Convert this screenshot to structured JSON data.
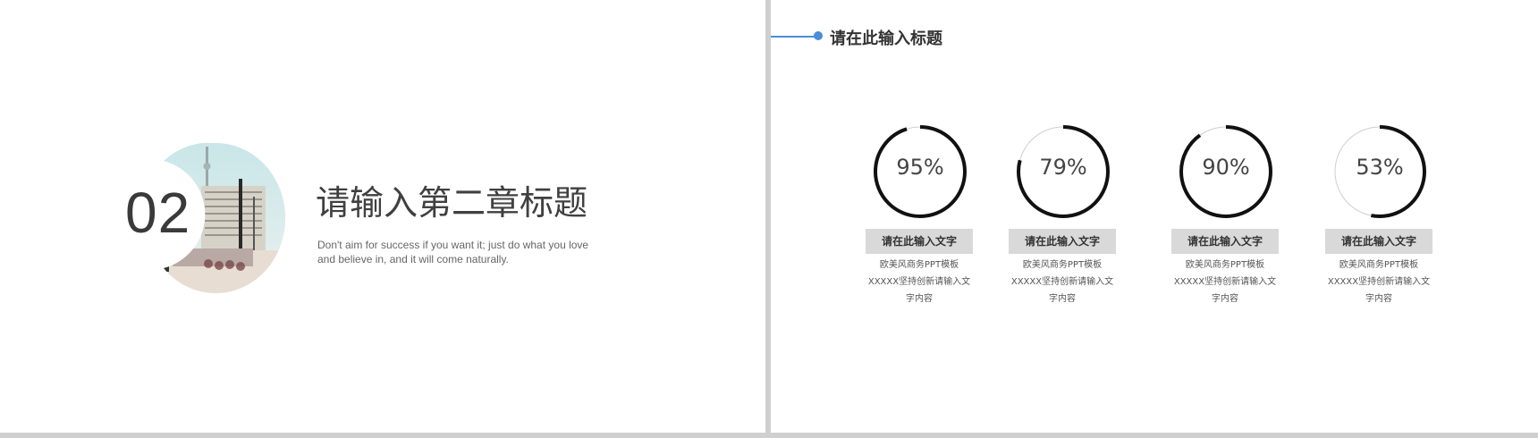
{
  "left_slide": {
    "chapter_number": "02",
    "chapter_title": "请输入第二章标题",
    "subtitle": "Don't aim for success if you want it; just do what you love and believe in, and it will come naturally.",
    "photo_description_icon": "city-street-photo-icon"
  },
  "right_slide": {
    "header_title": "请在此输入标题",
    "accent_color": "#4a8ed8",
    "stats": [
      {
        "percent_text": "95%",
        "value": 95,
        "label": "请在此输入文字",
        "desc_line1": "欧美风商务PPT模板",
        "desc_line2": "XXXXX坚持创新请输入文",
        "desc_line3": "字内容"
      },
      {
        "percent_text": "79%",
        "value": 79,
        "label": "请在此输入文字",
        "desc_line1": "欧美风商务PPT模板",
        "desc_line2": "XXXXX坚持创新请输入文",
        "desc_line3": "字内容"
      },
      {
        "percent_text": "90%",
        "value": 90,
        "label": "请在此输入文字",
        "desc_line1": "欧美风商务PPT模板",
        "desc_line2": "XXXXX坚持创新请输入文",
        "desc_line3": "字内容"
      },
      {
        "percent_text": "53%",
        "value": 53,
        "label": "请在此输入文字",
        "desc_line1": "欧美风商务PPT模板",
        "desc_line2": "XXXXX坚持创新请输入文",
        "desc_line3": "字内容"
      }
    ]
  }
}
